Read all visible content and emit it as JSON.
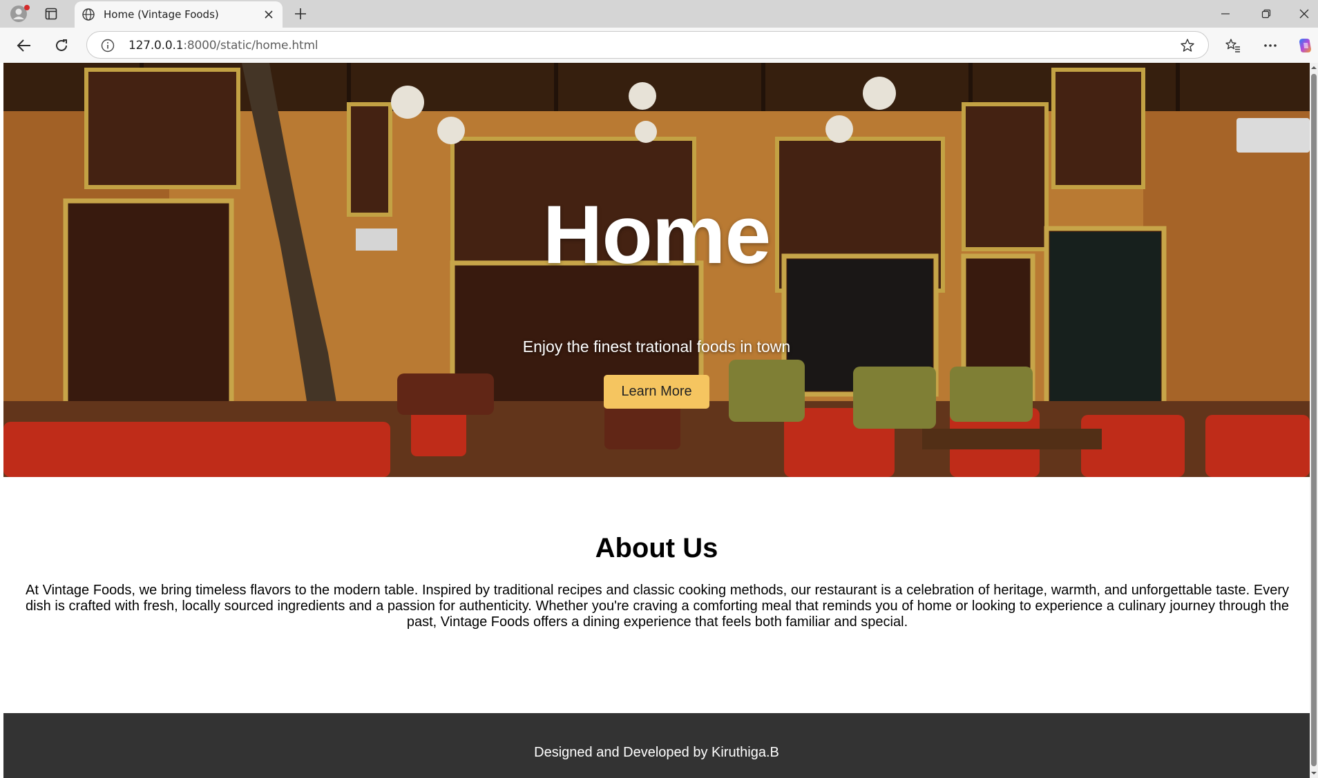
{
  "browser": {
    "tab_title": "Home (Vintage Foods)",
    "url_host": "127.0.0.1",
    "url_path": ":8000/static/home.html"
  },
  "icons": {
    "profile": "profile-icon",
    "tabs": "tab-actions-icon",
    "favicon": "globe-icon",
    "close": "close-icon",
    "new_tab": "plus-icon",
    "minimize": "minimize-icon",
    "restore": "restore-icon",
    "close_window": "close-window-icon",
    "back": "back-arrow-icon",
    "reload": "reload-icon",
    "site_info": "info-icon",
    "favorite": "star-icon",
    "favorites": "favorites-icon",
    "more": "more-icon",
    "copilot": "copilot-icon"
  },
  "hero": {
    "title": "Home",
    "subtitle": "Enjoy the finest trational foods in town",
    "button_label": "Learn More"
  },
  "about": {
    "title": "About Us",
    "text": "At Vintage Foods, we bring timeless flavors to the modern table. Inspired by traditional recipes and classic cooking methods, our restaurant is a celebration of heritage, warmth, and unforgettable taste. Every dish is crafted with fresh, locally sourced ingredients and a passion for authenticity. Whether you're craving a comforting meal that reminds you of home or looking to experience a culinary journey through the past, Vintage Foods offers a dining experience that feels both familiar and special."
  },
  "footer": {
    "text": "Designed and Developed by Kiruthiga.B"
  },
  "colors": {
    "button_bg": "#f5c560",
    "footer_bg": "#333333",
    "chrome_bg": "#d5d5d5",
    "toolbar_bg": "#f7f7f7"
  }
}
